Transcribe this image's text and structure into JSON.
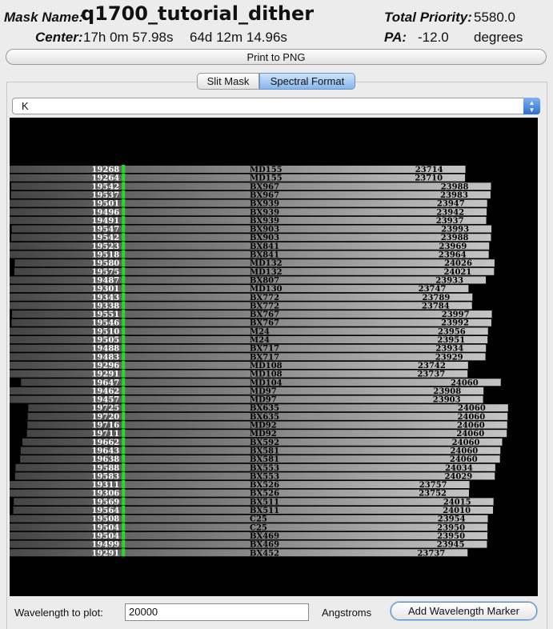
{
  "header": {
    "mask_name_label": "Mask Name:",
    "mask_name": "q1700_tutorial_dither",
    "total_priority_label": "Total Priority:",
    "total_priority": "5580.0",
    "center_label": "Center:",
    "center_ra": "17h 0m 57.98s",
    "center_dec": "64d 12m 14.96s",
    "pa_label": "PA:",
    "pa_value": "-12.0",
    "pa_units": "degrees"
  },
  "print_button": "Print to PNG",
  "tabs": [
    {
      "label": "Slit Mask",
      "selected": false
    },
    {
      "label": "Spectral Format",
      "selected": true
    }
  ],
  "filter_select": {
    "value": "K"
  },
  "spectra": [
    {
      "lo": "19268",
      "name": "MD155",
      "hi": "23714"
    },
    {
      "lo": "19264",
      "name": "MD155",
      "hi": "23710"
    },
    {
      "lo": "19542",
      "name": "BX967",
      "hi": "23988"
    },
    {
      "lo": "19537",
      "name": "BX967",
      "hi": "23983"
    },
    {
      "lo": "19501",
      "name": "BX939",
      "hi": "23947"
    },
    {
      "lo": "19496",
      "name": "BX939",
      "hi": "23942"
    },
    {
      "lo": "19491",
      "name": "BX939",
      "hi": "23937"
    },
    {
      "lo": "19547",
      "name": "BX903",
      "hi": "23993"
    },
    {
      "lo": "19542",
      "name": "BX903",
      "hi": "23988"
    },
    {
      "lo": "19523",
      "name": "BX841",
      "hi": "23969"
    },
    {
      "lo": "19518",
      "name": "BX841",
      "hi": "23964"
    },
    {
      "lo": "19580",
      "name": "MD132",
      "hi": "24026"
    },
    {
      "lo": "19575",
      "name": "MD132",
      "hi": "24021"
    },
    {
      "lo": "19487",
      "name": "BX807",
      "hi": "23933"
    },
    {
      "lo": "19301",
      "name": "MD130",
      "hi": "23747"
    },
    {
      "lo": "19343",
      "name": "BX772",
      "hi": "23789"
    },
    {
      "lo": "19338",
      "name": "BX772",
      "hi": "23784"
    },
    {
      "lo": "19551",
      "name": "BX767",
      "hi": "23997"
    },
    {
      "lo": "19546",
      "name": "BX767",
      "hi": "23992"
    },
    {
      "lo": "19510",
      "name": "M24",
      "hi": "23956"
    },
    {
      "lo": "19505",
      "name": "M24",
      "hi": "23951"
    },
    {
      "lo": "19488",
      "name": "BX717",
      "hi": "23934"
    },
    {
      "lo": "19483",
      "name": "BX717",
      "hi": "23929"
    },
    {
      "lo": "19296",
      "name": "MD108",
      "hi": "23742"
    },
    {
      "lo": "19291",
      "name": "MD108",
      "hi": "23737"
    },
    {
      "lo": "19647",
      "name": "MD104",
      "hi": "24060"
    },
    {
      "lo": "19462",
      "name": "MD97",
      "hi": "23908"
    },
    {
      "lo": "19457",
      "name": "MD97",
      "hi": "23903"
    },
    {
      "lo": "19725",
      "name": "BX635",
      "hi": "24060"
    },
    {
      "lo": "19720",
      "name": "BX635",
      "hi": "24060"
    },
    {
      "lo": "19716",
      "name": "MD92",
      "hi": "24060"
    },
    {
      "lo": "19711",
      "name": "MD92",
      "hi": "24060"
    },
    {
      "lo": "19662",
      "name": "BX592",
      "hi": "24060"
    },
    {
      "lo": "19643",
      "name": "BX581",
      "hi": "24060"
    },
    {
      "lo": "19638",
      "name": "BX581",
      "hi": "24060"
    },
    {
      "lo": "19588",
      "name": "BX553",
      "hi": "24034"
    },
    {
      "lo": "19583",
      "name": "BX553",
      "hi": "24029"
    },
    {
      "lo": "19311",
      "name": "BX526",
      "hi": "23757"
    },
    {
      "lo": "19306",
      "name": "BX526",
      "hi": "23752"
    },
    {
      "lo": "19569",
      "name": "BX511",
      "hi": "24015"
    },
    {
      "lo": "19564",
      "name": "BX511",
      "hi": "24010"
    },
    {
      "lo": "19508",
      "name": "C25",
      "hi": "23954"
    },
    {
      "lo": "19504",
      "name": "C25",
      "hi": "23950"
    },
    {
      "lo": "19504",
      "name": "BX469",
      "hi": "23950"
    },
    {
      "lo": "19499",
      "name": "BX469",
      "hi": "23945"
    },
    {
      "lo": "19291",
      "name": "BX452",
      "hi": "23737"
    }
  ],
  "wavelength_marker": {
    "value": 20000
  },
  "bottom": {
    "wavelength_label": "Wavelength to plot:",
    "wavelength_value": "20000",
    "units": "Angstroms",
    "add_button": "Add Wavelength Marker"
  },
  "colors": {
    "marker": "#22dd22",
    "cutoff": "#1a1a8c",
    "bar_left": "#444444",
    "bar_right": "#c4c4c4"
  }
}
